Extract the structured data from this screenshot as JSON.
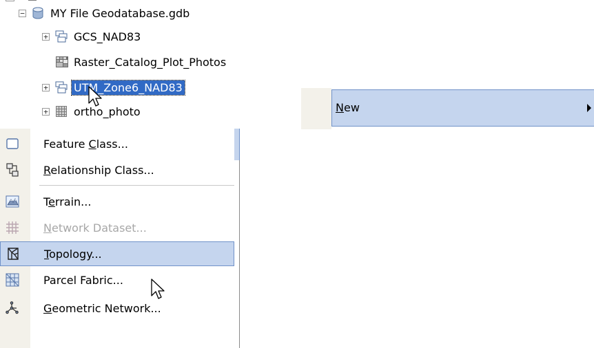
{
  "tree": {
    "geodatabase": {
      "toggle": "−",
      "label": "MY File Geodatabase.gdb"
    },
    "items": [
      {
        "toggle": "+",
        "label": "GCS_NAD83",
        "icon": "feature-dataset-icon"
      },
      {
        "toggle": "",
        "label": "Raster_Catalog_Plot_Photos",
        "icon": "raster-catalog-icon"
      },
      {
        "toggle": "+",
        "label": "UTM_Zone6_NAD83",
        "icon": "feature-dataset-icon",
        "selected": true
      },
      {
        "toggle": "+",
        "label": "ortho_photo",
        "icon": "raster-dataset-icon"
      }
    ]
  },
  "new_menu": {
    "label_hotkey": "N",
    "label_rest": "ew"
  },
  "context_menu": {
    "items": [
      {
        "pre": "Feature ",
        "hot": "C",
        "post": "lass...",
        "icon": "feature-class-icon",
        "disabled": false
      },
      {
        "pre": "",
        "hot": "R",
        "post": "elationship Class...",
        "icon": "relationship-class-icon",
        "disabled": false
      },
      {
        "pre": "T",
        "hot": "e",
        "post": "rrain...",
        "icon": "terrain-icon",
        "disabled": false
      },
      {
        "pre": "",
        "hot": "N",
        "post": "etwork Dataset...",
        "icon": "network-dataset-icon",
        "disabled": true
      },
      {
        "pre": "",
        "hot": "T",
        "post": "opology...",
        "icon": "topology-icon",
        "disabled": false,
        "highlighted": true
      },
      {
        "pre": "Parcel Fabric...",
        "hot": "",
        "post": "",
        "icon": "parcel-fabric-icon",
        "disabled": false
      },
      {
        "pre": "",
        "hot": "G",
        "post": "eometric Network...",
        "icon": "geometric-network-icon",
        "disabled": false
      }
    ]
  },
  "colors": {
    "selection": "#316ac5",
    "menu_highlight": "#c5d5ee",
    "menu_highlight_border": "#6f91c8",
    "menu_gutter": "#f3f1ea"
  }
}
